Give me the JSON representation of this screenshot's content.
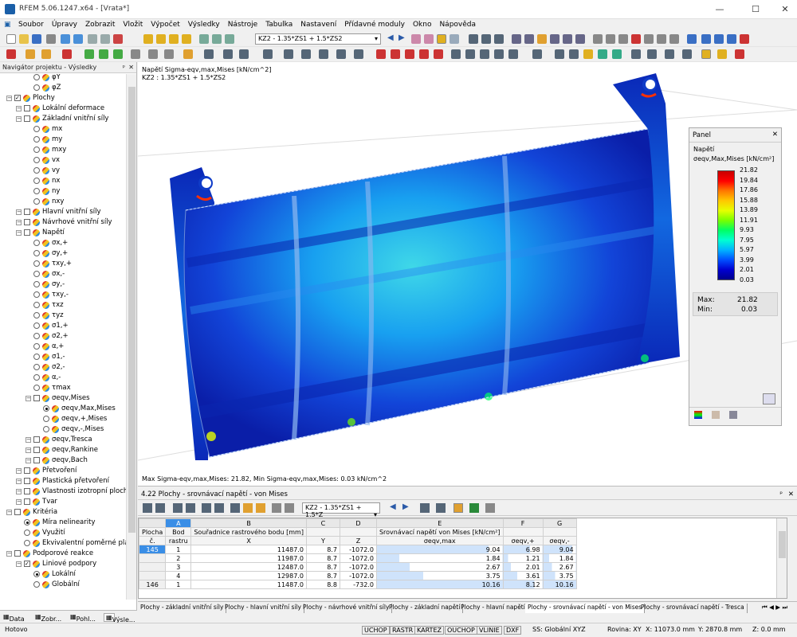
{
  "title": "RFEM 5.06.1247.x64 - [Vrata*]",
  "menu": [
    "Soubor",
    "Úpravy",
    "Zobrazit",
    "Vložit",
    "Výpočet",
    "Výsledky",
    "Nástroje",
    "Tabulka",
    "Nastavení",
    "Přídavné moduly",
    "Okno",
    "Nápověda"
  ],
  "toolbar": {
    "load_combo": "KZ2 - 1.35*ZS1 + 1.5*ZS2"
  },
  "nav": {
    "header": "Navigátor projektu - Výsledky",
    "items": [
      {
        "label": "φY",
        "kind": "radio",
        "level": 3
      },
      {
        "label": "φZ",
        "kind": "radio",
        "level": 3
      },
      {
        "label": "Plochy",
        "kind": "check",
        "level": 1,
        "checked": true
      },
      {
        "label": "Lokální deformace",
        "kind": "check",
        "level": 2
      },
      {
        "label": "Základní vnitřní síly",
        "kind": "check",
        "level": 2
      },
      {
        "label": "mx",
        "kind": "radio",
        "level": 3
      },
      {
        "label": "my",
        "kind": "radio",
        "level": 3
      },
      {
        "label": "mxy",
        "kind": "radio",
        "level": 3
      },
      {
        "label": "vx",
        "kind": "radio",
        "level": 3
      },
      {
        "label": "vy",
        "kind": "radio",
        "level": 3
      },
      {
        "label": "nx",
        "kind": "radio",
        "level": 3
      },
      {
        "label": "ny",
        "kind": "radio",
        "level": 3
      },
      {
        "label": "nxy",
        "kind": "radio",
        "level": 3
      },
      {
        "label": "Hlavní vnitřní síly",
        "kind": "check",
        "level": 2
      },
      {
        "label": "Návrhové vnitřní síly",
        "kind": "check",
        "level": 2
      },
      {
        "label": "Napětí",
        "kind": "check",
        "level": 2
      },
      {
        "label": "σx,+",
        "kind": "radio",
        "level": 3
      },
      {
        "label": "σy,+",
        "kind": "radio",
        "level": 3
      },
      {
        "label": "τxy,+",
        "kind": "radio",
        "level": 3
      },
      {
        "label": "σx,-",
        "kind": "radio",
        "level": 3
      },
      {
        "label": "σy,-",
        "kind": "radio",
        "level": 3
      },
      {
        "label": "τxy,-",
        "kind": "radio",
        "level": 3
      },
      {
        "label": "τxz",
        "kind": "radio",
        "level": 3
      },
      {
        "label": "τyz",
        "kind": "radio",
        "level": 3
      },
      {
        "label": "σ1,+",
        "kind": "radio",
        "level": 3
      },
      {
        "label": "σ2,+",
        "kind": "radio",
        "level": 3
      },
      {
        "label": "α,+",
        "kind": "radio",
        "level": 3
      },
      {
        "label": "σ1,-",
        "kind": "radio",
        "level": 3
      },
      {
        "label": "σ2,-",
        "kind": "radio",
        "level": 3
      },
      {
        "label": "α,-",
        "kind": "radio",
        "level": 3
      },
      {
        "label": "τmax",
        "kind": "radio",
        "level": 3
      },
      {
        "label": "σeqv,Mises",
        "kind": "check",
        "level": 3
      },
      {
        "label": "σeqv,Max,Mises",
        "kind": "radio",
        "level": 4,
        "selected": true
      },
      {
        "label": "σeqv,+,Mises",
        "kind": "radio",
        "level": 4
      },
      {
        "label": "σeqv,-,Mises",
        "kind": "radio",
        "level": 4
      },
      {
        "label": "σeqv,Tresca",
        "kind": "check",
        "level": 3
      },
      {
        "label": "σeqv,Rankine",
        "kind": "check",
        "level": 3
      },
      {
        "label": "σeqv,Bach",
        "kind": "check",
        "level": 3
      },
      {
        "label": "Přetvoření",
        "kind": "check",
        "level": 2
      },
      {
        "label": "Plastická přetvoření",
        "kind": "check",
        "level": 2
      },
      {
        "label": "Vlastnosti izotropní ploch",
        "kind": "check",
        "level": 2
      },
      {
        "label": "Tvar",
        "kind": "check",
        "level": 2
      },
      {
        "label": "Kritéria",
        "kind": "check",
        "level": 1
      },
      {
        "label": "Míra nelinearity",
        "kind": "radio",
        "level": 2,
        "selected": true
      },
      {
        "label": "Využití",
        "kind": "radio",
        "level": 2
      },
      {
        "label": "Ekvivalentní poměrné pla",
        "kind": "radio",
        "level": 2
      },
      {
        "label": "Podporové reakce",
        "kind": "check",
        "level": 1
      },
      {
        "label": "Liniové podpory",
        "kind": "check",
        "level": 2,
        "checked": true
      },
      {
        "label": "Lokální",
        "kind": "radio",
        "level": 3,
        "selected": true
      },
      {
        "label": "Globální",
        "kind": "radio",
        "level": 3
      }
    ],
    "tabs": [
      "Data",
      "Zobr...",
      "Pohl...",
      "Výsle..."
    ]
  },
  "view": {
    "header1": "Napětí Sigma-eqv,max,Mises [kN/cm^2]",
    "header2": "KZ2 : 1.35*ZS1 + 1.5*ZS2",
    "footer": "Max Sigma-eqv,max,Mises: 21.82, Min Sigma-eqv,max,Mises: 0.03 kN/cm^2"
  },
  "panel": {
    "title": "Panel",
    "section": "Napětí",
    "quantity": "σeqv,Max,Mises [kN/cm²]",
    "legend_values": [
      "21.82",
      "19.84",
      "17.86",
      "15.88",
      "13.89",
      "11.91",
      "9.93",
      "7.95",
      "5.97",
      "3.99",
      "2.01",
      "0.03"
    ],
    "legend_colors": [
      "#c80000",
      "#ff0000",
      "#ff7800",
      "#ffc800",
      "#e6ff00",
      "#78ff00",
      "#00ff64",
      "#00ffd2",
      "#00b4ff",
      "#0050ff",
      "#0000d2",
      "#00008c"
    ],
    "max_label": "Max:",
    "max_value": "21.82",
    "min_label": "Min:",
    "min_value": "0.03"
  },
  "table": {
    "title": "4.22 Plochy - srovnávací napětí - von Mises",
    "combo": "KZ2 - 1.35*ZS1 + 1.5*Z",
    "col_letters": [
      "A",
      "B",
      "C",
      "D",
      "E",
      "F",
      "G"
    ],
    "header_row1": [
      "Plocha",
      "Bod",
      "Souřadnice rastrového bodu [mm]",
      "",
      "",
      "Srovnávací napětí von Mises [kN/cm²]",
      "",
      ""
    ],
    "header_row2": [
      "č.",
      "rastru",
      "X",
      "Y",
      "Z",
      "σeqv,max",
      "σeqv,+",
      "σeqv,-"
    ],
    "rows": [
      [
        "145",
        "1",
        "11487.0",
        "8.7",
        "-1072.0",
        "9.04",
        "6.98",
        "9.04"
      ],
      [
        "",
        "2",
        "11987.0",
        "8.7",
        "-1072.0",
        "1.84",
        "1.21",
        "1.84"
      ],
      [
        "",
        "3",
        "12487.0",
        "8.7",
        "-1072.0",
        "2.67",
        "2.01",
        "2.67"
      ],
      [
        "",
        "4",
        "12987.0",
        "8.7",
        "-1072.0",
        "3.75",
        "3.61",
        "3.75"
      ],
      [
        "146",
        "1",
        "11487.0",
        "8.8",
        "-732.0",
        "10.16",
        "8.12",
        "10.16"
      ]
    ],
    "sheet_tabs": [
      "Plochy - základní vnitřní síly",
      "Plochy - hlavní vnitřní síly",
      "Plochy - návrhové vnitřní síly",
      "Plochy - základní napětí",
      "Plochy - hlavní napětí",
      "Plochy - srovnávací napětí - von Mises",
      "Plochy - srovnávací napětí - Tresca"
    ]
  },
  "status": {
    "left": "Hotovo",
    "buttons": [
      "UCHOP",
      "RASTR",
      "KARTEZ",
      "OUCHOP",
      "VLINIE",
      "DXF"
    ],
    "cs": "SS: Globální XYZ",
    "plane": "Rovina: XY",
    "x": "X: 11073.0 mm",
    "y": "Y: 2870.8 mm",
    "z": "Z: 0.0 mm"
  }
}
